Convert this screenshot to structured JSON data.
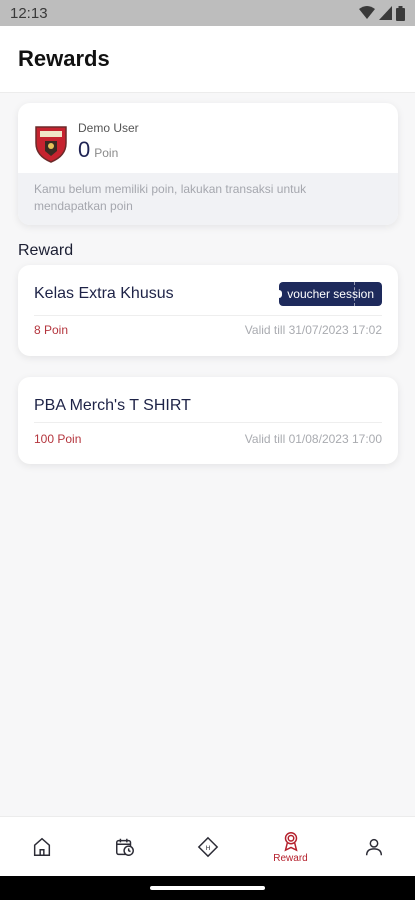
{
  "status_bar": {
    "time": "12:13"
  },
  "header": {
    "title": "Rewards"
  },
  "user": {
    "name": "Demo User",
    "points": "0",
    "points_unit": "Poin",
    "note": "Kamu belum memiliki poin, lakukan transaksi untuk mendapatkan poin"
  },
  "section": {
    "title": "Reward"
  },
  "rewards": [
    {
      "title": "Kelas Extra Khusus",
      "badge": "voucher session",
      "poin": "8 Poin",
      "valid": "Valid till 31/07/2023 17:02"
    },
    {
      "title": "PBA Merch's T SHIRT",
      "poin": "100 Poin",
      "valid": "Valid till 01/08/2023 17:00"
    }
  ],
  "nav": {
    "items": [
      {
        "icon": "home-icon",
        "label": ""
      },
      {
        "icon": "calendar-clock-icon",
        "label": ""
      },
      {
        "icon": "diamond-logo-icon",
        "label": ""
      },
      {
        "icon": "award-ribbon-icon",
        "label": "Reward",
        "active": true
      },
      {
        "icon": "profile-icon",
        "label": ""
      }
    ]
  },
  "colors": {
    "accent": "#b4202c",
    "navy": "#1e2a5c",
    "background": "#f7f7f8"
  }
}
